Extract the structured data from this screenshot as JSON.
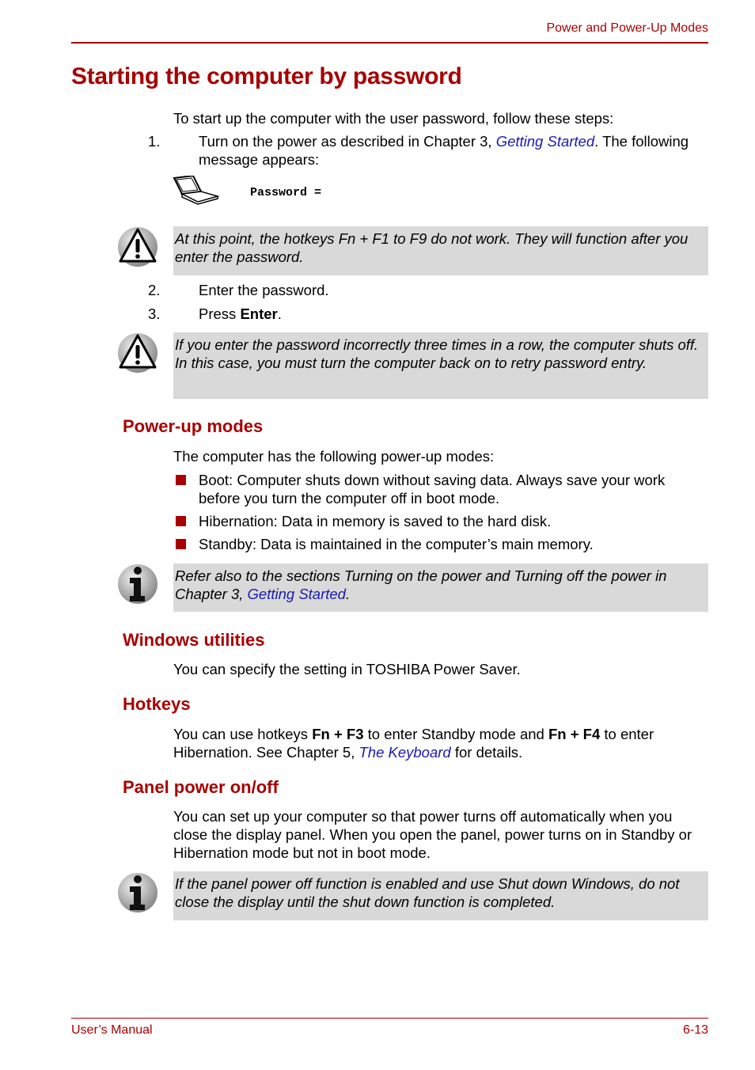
{
  "header": {
    "section": "Power and Power-Up Modes"
  },
  "title": "Starting the computer by password",
  "intro": "To start up the computer with the user password, follow these steps:",
  "steps": [
    {
      "num": "1.",
      "before": "Turn on the power as described in Chapter 3, ",
      "link": "Getting Started",
      "after": ". The following message appears:"
    },
    {
      "num": "2.",
      "text": "Enter the password."
    },
    {
      "num": "3.",
      "before": "Press ",
      "bold": "Enter",
      "after": "."
    }
  ],
  "message": {
    "icon": "laptop-icon",
    "text": "Password ="
  },
  "notes": {
    "hotkeys_warning": {
      "icon": "warning-icon",
      "text": "At this point, the hotkeys Fn + F1 to F9 do not work. They will function after you enter the password."
    },
    "incorrect_warning": {
      "icon": "warning-icon",
      "text": "If you enter the password incorrectly three times in a row, the computer shuts off. In this case, you must turn the computer back on to retry password entry."
    },
    "refer_info": {
      "icon": "info-icon",
      "before": "Refer also to the sections Turning on the power and Turning off the power in Chapter 3, ",
      "link": "Getting Started",
      "after": "."
    },
    "panel_info": {
      "icon": "info-icon",
      "text": "If the panel power off function is enabled and use Shut down Windows, do not close the display until the shut down function is completed."
    }
  },
  "powerup": {
    "heading": "Power-up modes",
    "intro": "The computer has the following power-up modes:",
    "items": [
      "Boot: Computer shuts down without saving data. Always save your work before you turn the computer off in boot mode.",
      "Hibernation: Data in memory is saved to the hard disk.",
      "Standby: Data is maintained in the computer’s main memory."
    ]
  },
  "windows_utilities": {
    "heading": "Windows utilities",
    "text": "You can specify the setting in TOSHIBA Power Saver."
  },
  "hotkeys": {
    "heading": "Hotkeys",
    "t1": "You can use hotkeys ",
    "b1": "Fn + F3",
    "t2": " to enter Standby mode and ",
    "b2": "Fn + F4",
    "t3": " to enter Hibernation. See Chapter 5, ",
    "link": "The Keyboard",
    "t4": " for details."
  },
  "panel_power": {
    "heading": "Panel power on/off",
    "text": "You can set up your computer so that power turns off automatically when you close the display panel. When you open the panel, power turns on in Standby or Hibernation mode but not in boot mode."
  },
  "footer": {
    "left": "User’s Manual",
    "right": "6-13"
  },
  "colors": {
    "accent": "#a80000",
    "link": "#1a1ab0",
    "note_bg": "#d9d9d9"
  }
}
